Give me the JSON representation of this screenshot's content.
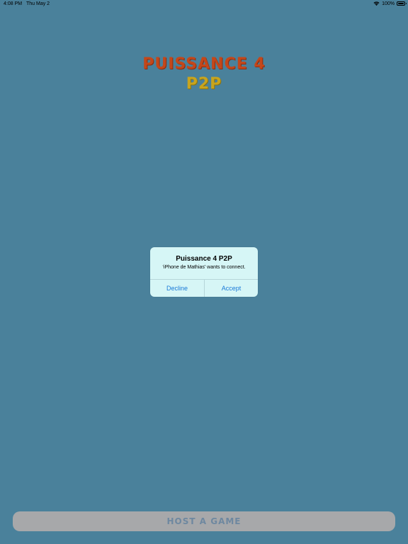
{
  "status_bar": {
    "time": "4:08 PM",
    "date": "Thu May 2",
    "battery_percent": "100%",
    "battery_level": 1.0,
    "wifi_icon": "wifi-icon",
    "battery_icon": "battery-icon"
  },
  "title": {
    "main": "PUISSANCE 4",
    "sub": "P2P",
    "main_color": "#c4471a",
    "sub_color": "#c8a41d"
  },
  "alert": {
    "title": "Puissance 4 P2P",
    "message": "‘iPhone de Mathias’ wants to connect.",
    "decline_label": "Decline",
    "accept_label": "Accept",
    "button_color": "#1a7ad8"
  },
  "host_button": {
    "label": "HOST A GAME"
  },
  "colors": {
    "background": "#4a819b"
  }
}
